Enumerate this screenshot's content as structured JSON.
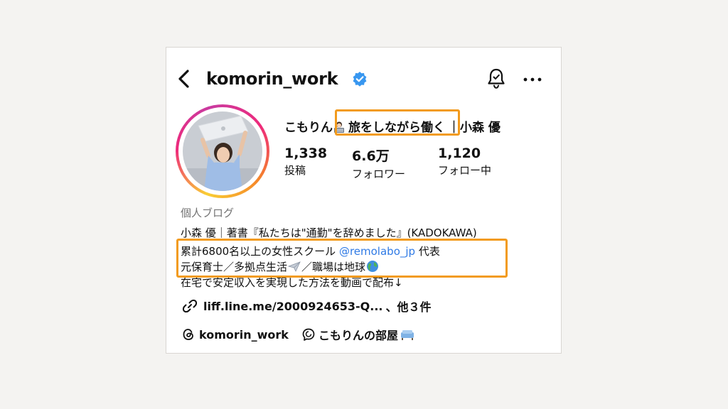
{
  "header": {
    "username": "komorin_work"
  },
  "profile": {
    "display_name_part1": "こもりん",
    "display_name_part2": "旅をしながら働く",
    "display_name_part3": "｜小森 優",
    "stats": [
      {
        "value": "1,338",
        "label": "投稿"
      },
      {
        "value": "6.6万",
        "label": "フォロワー"
      },
      {
        "value": "1,120",
        "label": "フォロー中"
      }
    ]
  },
  "bio": {
    "category": "個人ブログ",
    "line1": "小森 優｜著書『私たちは\"通勤\"を辞めました』(KADOKAWA)",
    "line2_prefix": "累計6800名以上の女性スクール ",
    "line2_mention": "@remolabo_jp",
    "line2_suffix": " 代表",
    "line3_a": "元保育士／多拠点生活",
    "line3_b": "／職場は地球",
    "line4": "在宅で安定収入を実現した方法を動画で配布↓"
  },
  "links": {
    "url_text": "liff.line.me/2000924653-Q...",
    "more_text": "、他３件"
  },
  "threads": {
    "label": "komorin_work",
    "room_label": "こもりんの部屋"
  },
  "colors": {
    "highlight": "#f29b1d",
    "mention": "#2f7ae5",
    "verified": "#3897f0"
  },
  "icons": [
    "back-arrow-icon",
    "verified-badge-icon",
    "notification-bell-icon",
    "more-options-icon",
    "link-icon",
    "threads-icon",
    "chat-icon"
  ]
}
